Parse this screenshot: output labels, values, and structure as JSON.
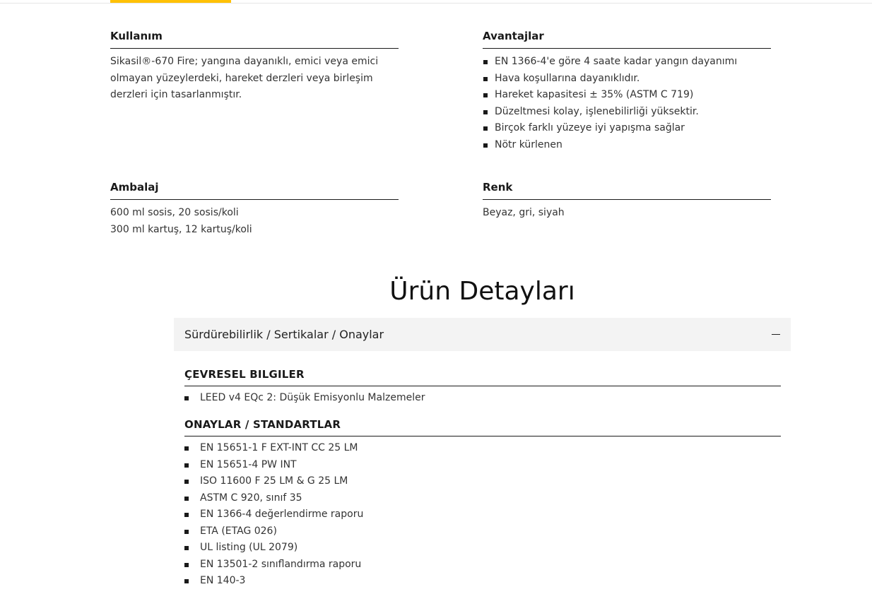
{
  "usage": {
    "heading": "Kullanım",
    "text": "Sikasil®-670 Fire; yangına dayanıklı, emici veya emici olmayan yüzeylerdeki, hareket derzleri veya birleşim derzleri için tasarlanmıştır."
  },
  "advantages": {
    "heading": "Avantajlar",
    "items": [
      "EN 1366-4'e göre 4 saate kadar yangın dayanımı",
      "Hava koşullarına dayanıklıdır.",
      "Hareket kapasitesi ± 35% (ASTM C 719)",
      "Düzeltmesi kolay, işlenebilirliği yüksektir.",
      "Birçok farklı yüzeye iyi yapışma sağlar",
      "Nötr kürlenen"
    ]
  },
  "packaging": {
    "heading": "Ambalaj",
    "lines": [
      "600 ml sosis, 20 sosis/koli",
      "300 ml kartuş, 12 kartuş/koli"
    ]
  },
  "color": {
    "heading": "Renk",
    "text": "Beyaz, gri, siyah"
  },
  "details": {
    "title": "Ürün Detayları",
    "accordion": {
      "title": "Sürdürebilirlik / Sertikalar / Onaylar",
      "expanded": true,
      "icon": "minus-icon"
    },
    "environmental": {
      "heading": "ÇEVRESEL BILGILER",
      "items": [
        "LEED v4 EQc 2: Düşük Emisyonlu Malzemeler"
      ]
    },
    "approvals": {
      "heading": "ONAYLAR / STANDARTLAR",
      "items": [
        "EN 15651-1 F EXT-INT CC 25 LM",
        "EN 15651-4 PW INT",
        "ISO 11600 F 25 LM & G 25 LM",
        "ASTM C 920, sınıf 35",
        "EN 1366-4 değerlendirme raporu",
        "ETA (ETAG 026)",
        "UL listing (UL 2079)",
        "EN 13501-2 sınıflandırma raporu",
        "EN 140-3"
      ]
    }
  },
  "colors": {
    "accent": "#ffc107",
    "accordion_bg": "#f3f3f3",
    "text": "#1a1a1a"
  }
}
